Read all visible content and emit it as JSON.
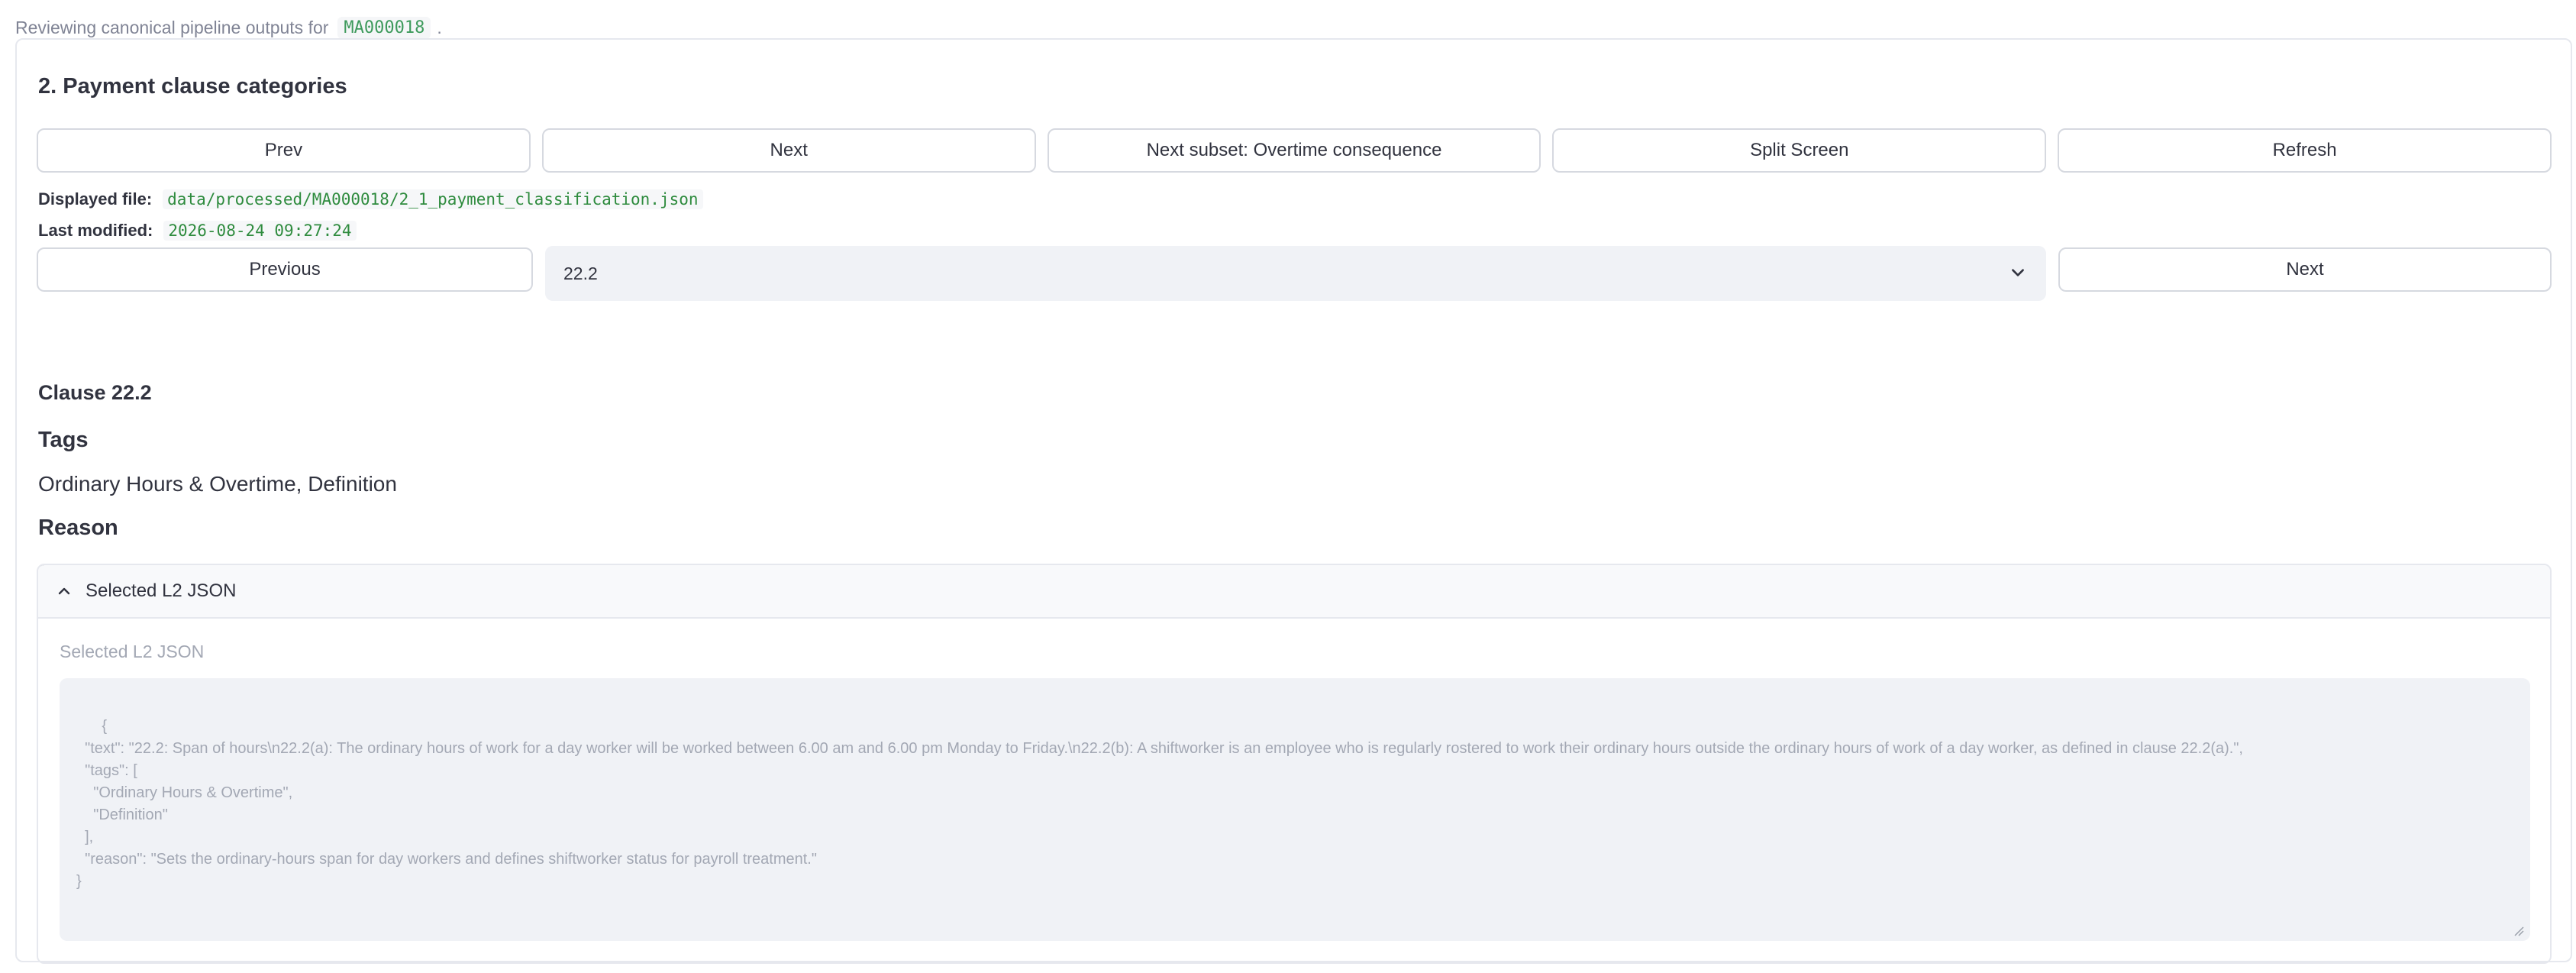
{
  "intro": {
    "text": "Reviewing canonical pipeline outputs for",
    "code": "MA000018",
    "suffix": "."
  },
  "section": {
    "title": "2. Payment clause categories"
  },
  "toolbar": {
    "prev_label": "Prev",
    "next_label": "Next",
    "next_subset_label": "Next subset: Overtime consequence",
    "split_label": "Split Screen",
    "refresh_label": "Refresh"
  },
  "file_info": {
    "displayed_label": "Displayed file:",
    "displayed_value": "data/processed/MA000018/2_1_payment_classification.json",
    "modified_label": "Last modified:",
    "modified_value": "2026-08-24 09:27:24"
  },
  "nav": {
    "previous_label": "Previous",
    "selected_clause": "22.2",
    "next_label": "Next"
  },
  "clause": {
    "title": "Clause 22.2",
    "tags_heading": "Tags",
    "tags_value": "Ordinary Hours & Overtime, Definition",
    "reason_heading": "Reason",
    "reason_value": "Sets the ordinary-hours span for day workers and defines shiftworker status for payroll treatment."
  },
  "expander": {
    "header": "Selected L2 JSON",
    "field_label": "Selected L2 JSON",
    "json_text": "{\n  \"text\": \"22.2: Span of hours\\n22.2(a): The ordinary hours of work for a day worker will be worked between 6.00 am and 6.00 pm Monday to Friday.\\n22.2(b): A shiftworker is an employee who is regularly rostered to work their ordinary hours outside the ordinary hours of work of a day worker, as defined in clause 22.2(a).\",\n  \"tags\": [\n    \"Ordinary Hours & Overtime\",\n    \"Definition\"\n  ],\n  \"reason\": \"Sets the ordinary-hours span for day workers and defines shiftworker status for payroll treatment.\"\n}"
  },
  "colors": {
    "accent_code": "#2e8b3e",
    "muted_text": "#a3a8b4",
    "border": "#e6e8ee"
  }
}
